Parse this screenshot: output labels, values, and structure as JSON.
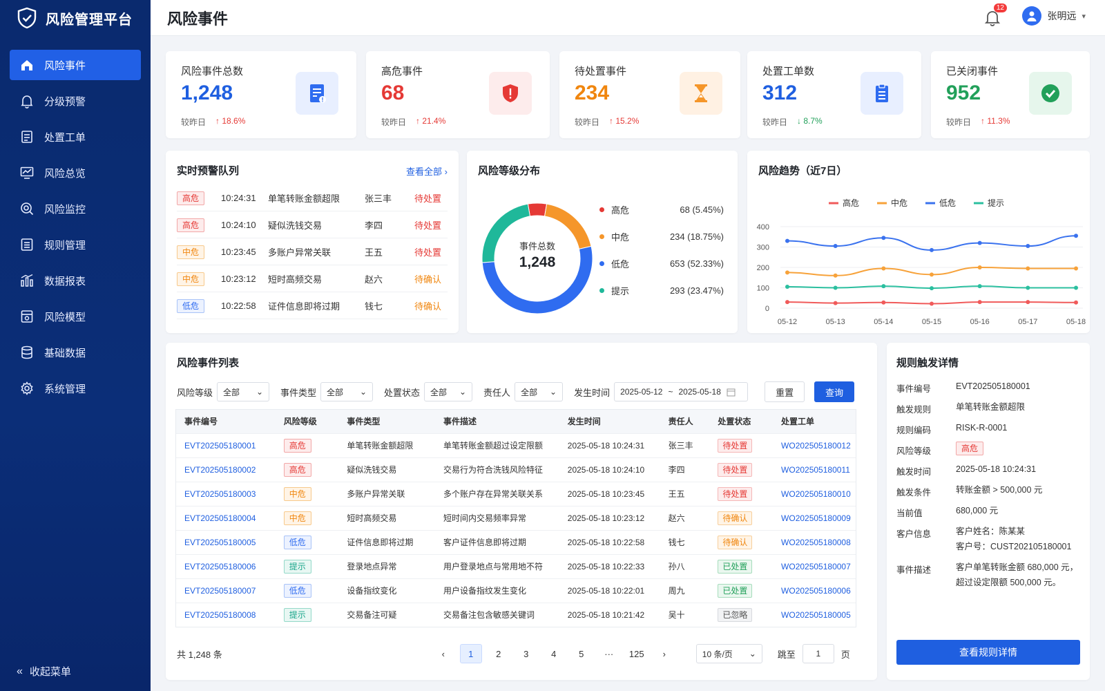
{
  "app": {
    "title": "风险管理平台"
  },
  "sidebar": {
    "items": [
      {
        "label": "风险事件",
        "icon": "home-icon",
        "active": true
      },
      {
        "label": "分级预警",
        "icon": "bell-icon"
      },
      {
        "label": "处置工单",
        "icon": "document-icon"
      },
      {
        "label": "风险总览",
        "icon": "monitor-chart-icon"
      },
      {
        "label": "风险监控",
        "icon": "target-icon"
      },
      {
        "label": "规则管理",
        "icon": "list-icon"
      },
      {
        "label": "数据报表",
        "icon": "bar-chart-icon"
      },
      {
        "label": "风险模型",
        "icon": "model-icon"
      },
      {
        "label": "基础数据",
        "icon": "database-icon"
      },
      {
        "label": "系统管理",
        "icon": "gear-icon"
      }
    ],
    "collapse_label": "收起菜单"
  },
  "header": {
    "page_title": "风险事件",
    "notification_count": "12",
    "user_name": "张明远"
  },
  "stats": [
    {
      "label": "风险事件总数",
      "value": "1,248",
      "cmp_label": "较昨日",
      "arrow": "↑",
      "change": "18.6%",
      "value_color": "#1f5fe0",
      "change_color": "#e53935"
    },
    {
      "label": "高危事件",
      "value": "68",
      "cmp_label": "较昨日",
      "arrow": "↑",
      "change": "21.4%",
      "value_color": "#e53935",
      "change_color": "#e53935"
    },
    {
      "label": "待处置事件",
      "value": "234",
      "cmp_label": "较昨日",
      "arrow": "↑",
      "change": "15.2%",
      "value_color": "#f0860e",
      "change_color": "#e53935"
    },
    {
      "label": "处置工单数",
      "value": "312",
      "cmp_label": "较昨日",
      "arrow": "↓",
      "change": "8.7%",
      "value_color": "#1f5fe0",
      "change_color": "#22a05a"
    },
    {
      "label": "已关闭事件",
      "value": "952",
      "cmp_label": "较昨日",
      "arrow": "↑",
      "change": "11.3%",
      "value_color": "#22a05a",
      "change_color": "#e53935"
    }
  ],
  "queue": {
    "title": "实时预警队列",
    "view_all": "查看全部 ›",
    "rows": [
      {
        "level": "高危",
        "lvl": "high",
        "time": "10:24:31",
        "desc": "单笔转账金额超限",
        "person": "张三丰",
        "status": "待处置",
        "st": "pending"
      },
      {
        "level": "高危",
        "lvl": "high",
        "time": "10:24:10",
        "desc": "疑似洗钱交易",
        "person": "李四",
        "status": "待处置",
        "st": "pending"
      },
      {
        "level": "中危",
        "lvl": "mid",
        "time": "10:23:45",
        "desc": "多账户异常关联",
        "person": "王五",
        "status": "待处置",
        "st": "pending"
      },
      {
        "level": "中危",
        "lvl": "mid",
        "time": "10:23:12",
        "desc": "短时高频交易",
        "person": "赵六",
        "status": "待确认",
        "st": "confirm"
      },
      {
        "level": "低危",
        "lvl": "low",
        "time": "10:22:58",
        "desc": "证件信息即将过期",
        "person": "钱七",
        "status": "待确认",
        "st": "confirm"
      }
    ]
  },
  "distribution": {
    "title": "风险等级分布",
    "center_label": "事件总数",
    "center_value": "1,248",
    "items": [
      {
        "name": "高危",
        "value": 68,
        "text": "68 (5.45%)",
        "color": "#e53935"
      },
      {
        "name": "中危",
        "value": 234,
        "text": "234 (18.75%)",
        "color": "#f5962a"
      },
      {
        "name": "低危",
        "value": 653,
        "text": "653 (52.33%)",
        "color": "#2f6cf0"
      },
      {
        "name": "提示",
        "value": 293,
        "text": "293 (23.47%)",
        "color": "#1fb89a"
      }
    ]
  },
  "chart_data": {
    "type": "line",
    "title": "风险趋势（近7日）",
    "categories": [
      "05-12",
      "05-13",
      "05-14",
      "05-15",
      "05-16",
      "05-17",
      "05-18"
    ],
    "ylim": [
      0,
      400
    ],
    "yticks": [
      0,
      100,
      200,
      300,
      400
    ],
    "series": [
      {
        "name": "高危",
        "color": "#f05a5a",
        "values": [
          30,
          25,
          28,
          22,
          30,
          30,
          28
        ]
      },
      {
        "name": "中危",
        "color": "#f7a23a",
        "values": [
          175,
          160,
          195,
          165,
          200,
          195,
          195
        ]
      },
      {
        "name": "低危",
        "color": "#3a72ee",
        "values": [
          330,
          305,
          345,
          285,
          320,
          305,
          355
        ]
      },
      {
        "name": "提示",
        "color": "#2bbf9f",
        "values": [
          105,
          100,
          108,
          98,
          108,
          100,
          100
        ]
      }
    ],
    "legend": "top",
    "grid": true
  },
  "events": {
    "title": "风险事件列表",
    "filters": {
      "level_label": "风险等级",
      "level_value": "全部",
      "type_label": "事件类型",
      "type_value": "全部",
      "status_label": "处置状态",
      "status_value": "全部",
      "owner_label": "责任人",
      "owner_value": "全部",
      "time_label": "发生时间",
      "date_from": "2025-05-12",
      "date_sep": "~",
      "date_to": "2025-05-18",
      "reset": "重置",
      "query": "查询"
    },
    "columns": [
      "事件编号",
      "风险等级",
      "事件类型",
      "事件描述",
      "发生时间",
      "责任人",
      "处置状态",
      "处置工单"
    ],
    "rows": [
      {
        "id": "EVT202505180001",
        "level": "高危",
        "lvl": "high",
        "type": "单笔转账金额超限",
        "desc": "单笔转账金额超过设定限额",
        "time": "2025-05-18 10:24:31",
        "owner": "张三丰",
        "status": "待处置",
        "st": "pending",
        "wo": "WO202505180012"
      },
      {
        "id": "EVT202505180002",
        "level": "高危",
        "lvl": "high",
        "type": "疑似洗钱交易",
        "desc": "交易行为符合洗钱风险特征",
        "time": "2025-05-18 10:24:10",
        "owner": "李四",
        "status": "待处置",
        "st": "pending",
        "wo": "WO202505180011"
      },
      {
        "id": "EVT202505180003",
        "level": "中危",
        "lvl": "mid",
        "type": "多账户异常关联",
        "desc": "多个账户存在异常关联关系",
        "time": "2025-05-18 10:23:45",
        "owner": "王五",
        "status": "待处置",
        "st": "pending",
        "wo": "WO202505180010"
      },
      {
        "id": "EVT202505180004",
        "level": "中危",
        "lvl": "mid",
        "type": "短时高频交易",
        "desc": "短时间内交易频率异常",
        "time": "2025-05-18 10:23:12",
        "owner": "赵六",
        "status": "待确认",
        "st": "confirm",
        "wo": "WO202505180009"
      },
      {
        "id": "EVT202505180005",
        "level": "低危",
        "lvl": "low",
        "type": "证件信息即将过期",
        "desc": "客户证件信息即将过期",
        "time": "2025-05-18 10:22:58",
        "owner": "钱七",
        "status": "待确认",
        "st": "confirm",
        "wo": "WO202505180008"
      },
      {
        "id": "EVT202505180006",
        "level": "提示",
        "lvl": "hint",
        "type": "登录地点异常",
        "desc": "用户登录地点与常用地不符",
        "time": "2025-05-18 10:22:33",
        "owner": "孙八",
        "status": "已处置",
        "st": "done",
        "wo": "WO202505180007"
      },
      {
        "id": "EVT202505180007",
        "level": "低危",
        "lvl": "low",
        "type": "设备指纹变化",
        "desc": "用户设备指纹发生变化",
        "time": "2025-05-18 10:22:01",
        "owner": "周九",
        "status": "已处置",
        "st": "done",
        "wo": "WO202505180006"
      },
      {
        "id": "EVT202505180008",
        "level": "提示",
        "lvl": "hint",
        "type": "交易备注可疑",
        "desc": "交易备注包含敏感关键词",
        "time": "2025-05-18 10:21:42",
        "owner": "吴十",
        "status": "已忽略",
        "st": "ignore",
        "wo": "WO202505180005"
      }
    ],
    "pagination": {
      "total": "共 1,248 条",
      "pages": [
        "1",
        "2",
        "3",
        "4",
        "5",
        "···",
        "125"
      ],
      "page_size": "10 条/页",
      "goto_label": "跳至",
      "goto_value": "1",
      "page_unit": "页"
    }
  },
  "detail": {
    "title": "规则触发详情",
    "rows": [
      {
        "k": "事件编号",
        "v": "EVT202505180001"
      },
      {
        "k": "触发规则",
        "v": "单笔转账金额超限"
      },
      {
        "k": "规则编码",
        "v": "RISK-R-0001"
      },
      {
        "k": "风险等级",
        "v": "高危",
        "tag": "high"
      },
      {
        "k": "触发时间",
        "v": "2025-05-18 10:24:31"
      },
      {
        "k": "触发条件",
        "v": "转账金额 > 500,000 元"
      },
      {
        "k": "当前值",
        "v": "680,000 元"
      },
      {
        "k": "客户信息",
        "v": "客户姓名：陈某某",
        "v2": "客户号：CUST202105180001"
      },
      {
        "k": "事件描述",
        "v": "客户单笔转账金额 680,000 元，",
        "v2": "超过设定限额 500,000 元。"
      }
    ],
    "button": "查看规则详情"
  }
}
